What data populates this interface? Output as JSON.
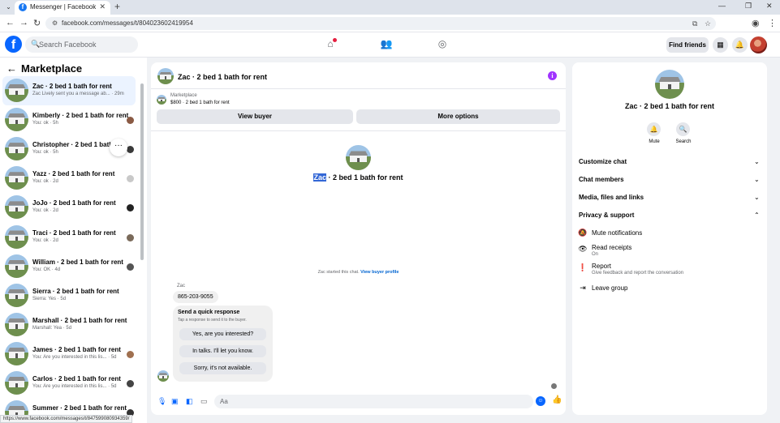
{
  "browser": {
    "tab_title": "Messenger | Facebook",
    "url": "facebook.com/messages/t/804023602419954",
    "status_url": "https://www.facebook.com/messages/t/847599080934359/"
  },
  "header": {
    "search_placeholder": "Search Facebook",
    "find_friends": "Find friends"
  },
  "sidebar": {
    "title": "Marketplace",
    "conversations": [
      {
        "name": "Zac · 2 bed 1 bath for rent",
        "preview": "Zac Lively sent you a message ab... · 29m"
      },
      {
        "name": "Kimberly · 2 bed 1 bath for rent",
        "preview": "You: ok · 5h"
      },
      {
        "name": "Christopher · 2 bed 1 bath fo",
        "preview": "You: ok · 5h"
      },
      {
        "name": "Yazz · 2 bed 1 bath for rent",
        "preview": "You: ok · 2d"
      },
      {
        "name": "JoJo · 2 bed 1 bath for rent",
        "preview": "You: ok · 2d"
      },
      {
        "name": "Traci · 2 bed 1 bath for rent",
        "preview": "You: ok · 2d"
      },
      {
        "name": "William · 2 bed 1 bath for rent",
        "preview": "You: OK · 4d"
      },
      {
        "name": "Sierra · 2 bed 1 bath for rent",
        "preview": "Sierra: Yes · 5d"
      },
      {
        "name": "Marshall · 2 bed 1 bath for rent",
        "preview": "Marshall: Yea · 5d"
      },
      {
        "name": "James · 2 bed 1 bath for rent",
        "preview": "You: Are you interested in this lis... · 5d"
      },
      {
        "name": "Carlos · 2 bed 1 bath for rent",
        "preview": "You: Are you interested in this lis... · 5d"
      },
      {
        "name": "Summer · 2 bed 1 bath for rent",
        "preview": ""
      }
    ],
    "more_glyph": "···"
  },
  "chat": {
    "title": "Zac · 2 bed 1 bath for rent",
    "marketplace_label": "Marketplace",
    "listing": "$800 · 2 bed 1 bath for rent",
    "view_buyer": "View buyer",
    "more_options": "More options",
    "center_name_highlight": "Zac",
    "center_name_rest": " · 2 bed 1 bath for rent",
    "started_text": "Zac started this chat.",
    "started_link": "View buyer profile",
    "sender": "Zac",
    "message": "865-203-9055",
    "quick_title": "Send a quick response",
    "quick_sub": "Tap a response to send it to the buyer.",
    "quick_options": [
      "Yes, are you interested?",
      "In talks. I'll let you know.",
      "Sorry, it's not available."
    ],
    "composer_placeholder": "Aa"
  },
  "details": {
    "title": "Zac · 2 bed 1 bath for rent",
    "mute": "Mute",
    "search": "Search",
    "sections": [
      "Customize chat",
      "Chat members",
      "Media, files and links",
      "Privacy & support"
    ],
    "privacy_items": [
      {
        "label": "Mute notifications",
        "sub": ""
      },
      {
        "label": "Read receipts",
        "sub": "On"
      },
      {
        "label": "Report",
        "sub": "Give feedback and report the conversation"
      },
      {
        "label": "Leave group",
        "sub": ""
      }
    ]
  },
  "colors": {
    "accent": "#0866ff",
    "info": "#a033ff",
    "active_row": "#ebf3ff"
  }
}
